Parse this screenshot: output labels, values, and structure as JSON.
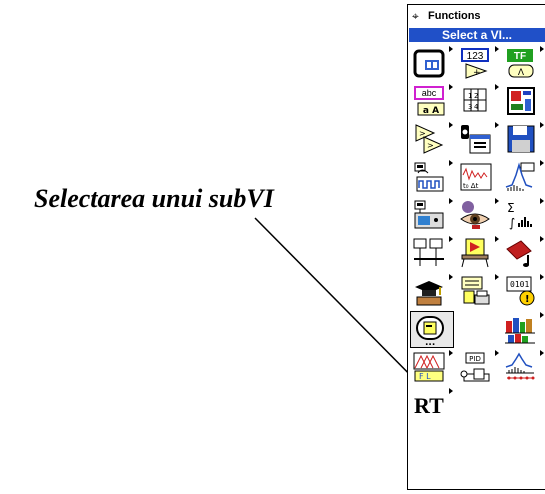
{
  "caption": "Selectarea unui subVI",
  "palette": {
    "title": "Functions",
    "pin_glyph": "⌖",
    "select_button": "Select a VI...",
    "icons": [
      [
        "structures-icon",
        "numeric-icon",
        "boolean-icon"
      ],
      [
        "string-icon",
        "array-icon",
        "cluster-icon"
      ],
      [
        "comparison-icon",
        "time-dialog-icon",
        "file-io-icon"
      ],
      [
        "data-acquisition-icon",
        "waveform-icon",
        "analyze-icon"
      ],
      [
        "instrument-io-icon",
        "motion-vision-icon",
        "mathematics-icon"
      ],
      [
        "communication-icon",
        "application-control-icon",
        "graphics-sound-icon"
      ],
      [
        "tutorial-icon",
        "report-generation-icon",
        "advanced-icon"
      ],
      [
        "select-vi-icon",
        "",
        "user-libraries-icon"
      ],
      [
        "fuzzy-logic-icon",
        "pid-control-icon",
        "signal-processing-icon"
      ],
      [
        "rt-icon",
        "",
        ""
      ]
    ],
    "rt_label": "RT",
    "pid_label": "PID",
    "numeric_label": "123",
    "boolean_label": "TF",
    "string_label": "abc",
    "array_label": "1 2\n3 4"
  }
}
